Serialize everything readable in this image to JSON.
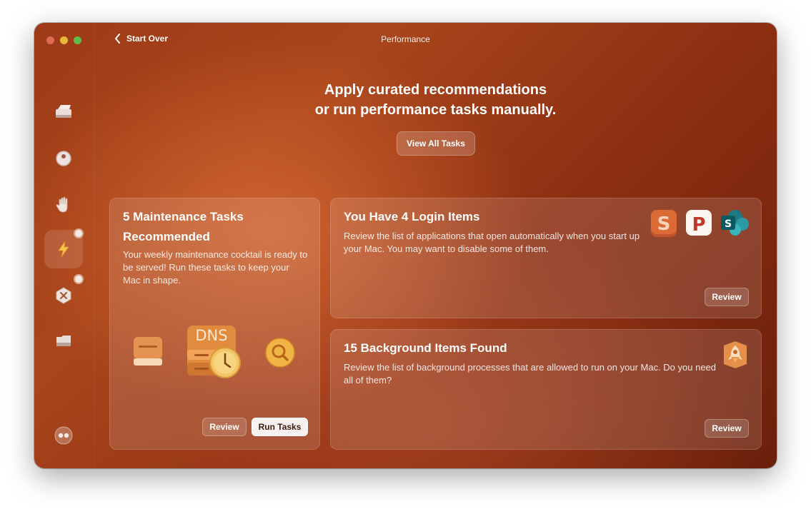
{
  "window": {
    "title": "Performance",
    "start_over_label": "Start Over"
  },
  "header": {
    "line1": "Apply curated recommendations",
    "line2": "or run performance tasks manually.",
    "view_all_label": "View All Tasks"
  },
  "sidebar": {
    "items": [
      {
        "icon": "disk-cleanup-icon"
      },
      {
        "icon": "protection-icon"
      },
      {
        "icon": "privacy-hand-icon"
      },
      {
        "icon": "performance-bolt-icon",
        "active": true
      },
      {
        "icon": "applications-icon"
      },
      {
        "icon": "files-folder-icon"
      },
      {
        "icon": "assistant-icon"
      }
    ]
  },
  "maintenance_card": {
    "title_line1": "5 Maintenance Tasks",
    "title_line2": "Recommended",
    "description": "Your weekly maintenance cocktail is ready to be served! Run these tasks to keep your Mac in shape.",
    "dns_label": "DNS",
    "review_label": "Review",
    "run_label": "Run Tasks"
  },
  "login_card": {
    "title": "You Have 4 Login Items",
    "description": "Review the list of applications that open automatically when you start up your Mac. You may want to disable some of them.",
    "review_label": "Review",
    "app_letters": [
      "S",
      "P",
      "S"
    ]
  },
  "background_card": {
    "title": "15 Background Items Found",
    "description": "Review the list of background processes that are allowed to run on your Mac. Do you need all of them?",
    "review_label": "Review"
  }
}
